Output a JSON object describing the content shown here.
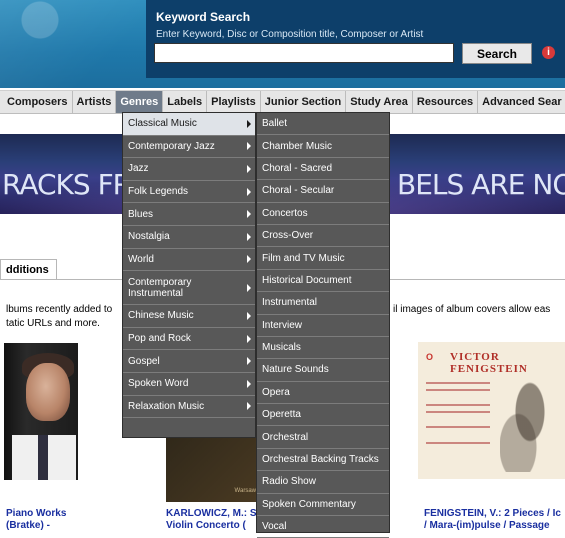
{
  "search": {
    "title": "Keyword Search",
    "hint": "Enter Keyword, Disc or Composition title, Composer or Artist",
    "value": "",
    "button": "Search",
    "info_icon": "info-icon"
  },
  "nav": {
    "items": [
      "Composers",
      "Artists",
      "Genres",
      "Labels",
      "Playlists",
      "Junior Section",
      "Study Area",
      "Resources",
      "Advanced Sear"
    ],
    "active": "Genres"
  },
  "banner": {
    "left_text": "RACKS FRC",
    "right_text": "BELS ARE NOW A"
  },
  "tab": {
    "label": "dditions"
  },
  "description": {
    "line1_left": "lbums recently added to",
    "line1_right": "il images of album covers allow eas",
    "line2": "tatic URLs and more."
  },
  "albums": [
    {
      "line1": "Piano Works",
      "line2": "(Bratke) -"
    },
    {
      "line1": "KARLOWICZ, M.: S",
      "line2": "Violin Concerto (",
      "cover_text": "Warsaw"
    },
    {
      "line1": "FENIGSTEIN, V.: 2 Pieces / Ic",
      "line2": "/ Mara-(im)pulse / Passage",
      "cover_title": "VICTOR FENIGSTEIN",
      "cover_logo": "O"
    }
  ],
  "genres_menu": {
    "items": [
      {
        "label": "Classical Music",
        "submenu": true,
        "selected": true
      },
      {
        "label": "Contemporary Jazz",
        "submenu": true
      },
      {
        "label": "Jazz",
        "submenu": true
      },
      {
        "label": "Folk Legends",
        "submenu": true
      },
      {
        "label": "Blues",
        "submenu": true
      },
      {
        "label": "Nostalgia",
        "submenu": true
      },
      {
        "label": "World",
        "submenu": true
      },
      {
        "label": "Contemporary Instrumental",
        "submenu": true
      },
      {
        "label": "Chinese Music",
        "submenu": true
      },
      {
        "label": "Pop and Rock",
        "submenu": true
      },
      {
        "label": "Gospel",
        "submenu": true
      },
      {
        "label": "Spoken Word",
        "submenu": true
      },
      {
        "label": "Relaxation Music",
        "submenu": true
      }
    ]
  },
  "classical_menu": {
    "items": [
      "Ballet",
      "Chamber Music",
      "Choral - Sacred",
      "Choral - Secular",
      "Concertos",
      "Cross-Over",
      "Film and TV Music",
      "Historical Document",
      "Instrumental",
      "Interview",
      "Musicals",
      "Nature Sounds",
      "Opera",
      "Operetta",
      "Orchestral",
      "Orchestral Backing Tracks",
      "Radio Show",
      "Spoken Commentary",
      "Vocal"
    ]
  },
  "colors": {
    "header": "#1f78aa",
    "search_panel": "#0d3f6a",
    "menu_bg": "#585858",
    "menu_selected": "#dfe3e8",
    "nav_active": "#6f7b8a",
    "caption_link": "#1a2fa0"
  }
}
